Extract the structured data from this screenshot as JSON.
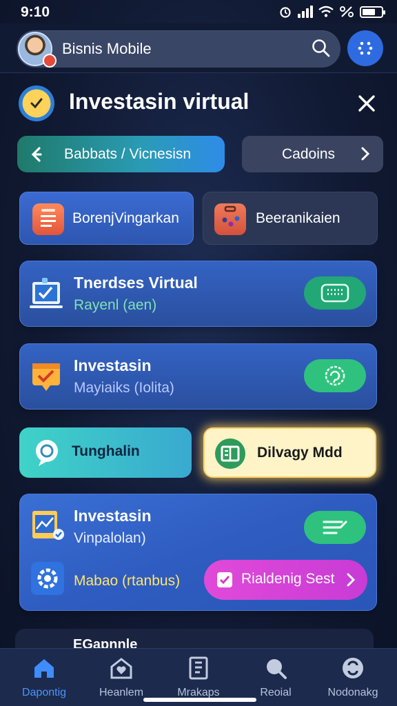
{
  "status_bar": {
    "time": "9:10"
  },
  "header": {
    "app_name": "Bisnis Mobile"
  },
  "panel": {
    "title": "Investasin virtual"
  },
  "tabs": [
    {
      "label": "Babbats / Vicnesisn"
    },
    {
      "label": "Cadoins"
    }
  ],
  "quick_cards": [
    {
      "label": "BorenjVingarkan"
    },
    {
      "label": "Beeranikaien"
    }
  ],
  "rows": [
    {
      "title": "Tnerdses Virtual",
      "subtitle": "Rayenl (aen)"
    },
    {
      "title": "Investasin",
      "subtitle": "Mayiaiks (Iolita)"
    },
    {
      "title": "Investasin",
      "subtitle": "Vinpalolan)"
    }
  ],
  "toggles": [
    {
      "label": "Tunghalin"
    },
    {
      "label": "Dilvagy Mdd"
    }
  ],
  "settings_row": {
    "label": "Mabao (rtanbus)"
  },
  "action_button": {
    "label": "Rialdenig Sest"
  },
  "peek_card": {
    "label": "EGapnnle"
  },
  "nav": [
    {
      "label": "Dapontig",
      "active": true
    },
    {
      "label": "Heanlem",
      "active": false
    },
    {
      "label": "Mrakaps",
      "active": false
    },
    {
      "label": "Reoial",
      "active": false
    },
    {
      "label": "Nodonakg",
      "active": false
    }
  ],
  "colors": {
    "accent_blue": "#2f6be0",
    "green": "#2ec27e",
    "magenta": "#d745d7",
    "highlight_yellow": "#ffd26a"
  }
}
